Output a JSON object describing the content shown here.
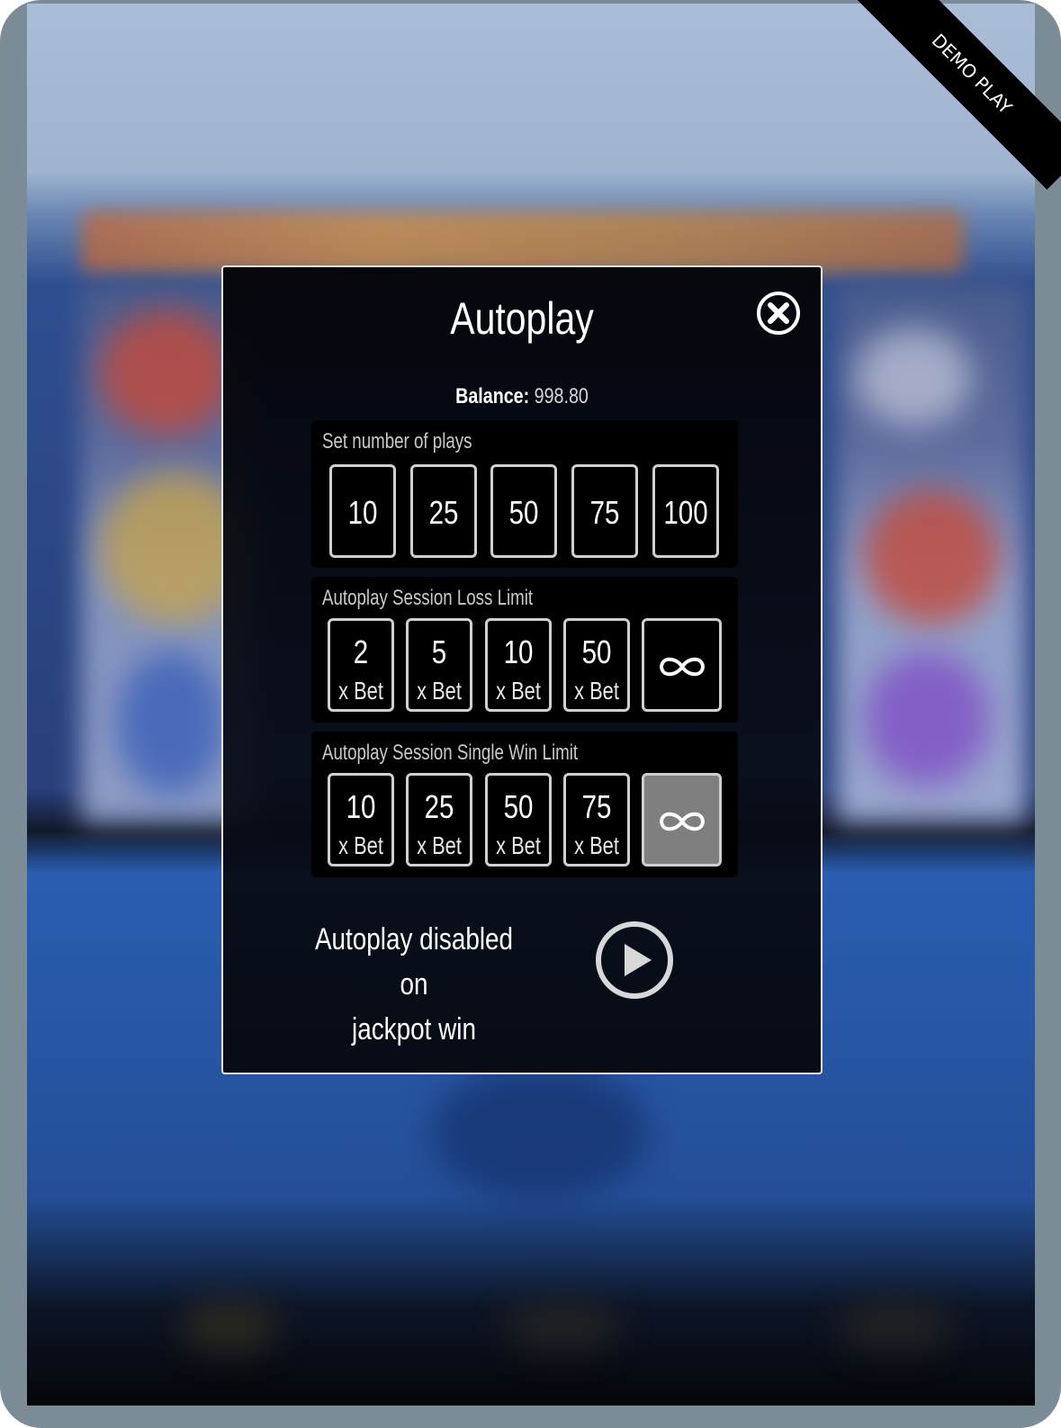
{
  "demo_ribbon": {
    "label": "DEMO PLAY"
  },
  "modal": {
    "title": "Autoplay",
    "close_icon": "close-circle-icon",
    "balance": {
      "label": "Balance:",
      "value": "998.80"
    }
  },
  "plays": {
    "label": "Set number of plays",
    "options": [
      "10",
      "25",
      "50",
      "75",
      "100"
    ]
  },
  "loss_limit": {
    "label": "Autoplay Session Loss Limit",
    "options": [
      {
        "value": "2",
        "suffix": "x Bet"
      },
      {
        "value": "5",
        "suffix": "x Bet"
      },
      {
        "value": "10",
        "suffix": "x Bet"
      },
      {
        "value": "50",
        "suffix": "x Bet"
      }
    ],
    "infinite_icon": "infinity-icon",
    "selected": "none"
  },
  "win_limit": {
    "label": "Autoplay Session Single Win Limit",
    "options": [
      {
        "value": "10",
        "suffix": "x Bet"
      },
      {
        "value": "25",
        "suffix": "x Bet"
      },
      {
        "value": "50",
        "suffix": "x Bet"
      },
      {
        "value": "75",
        "suffix": "x Bet"
      }
    ],
    "infinite_icon": "infinity-icon",
    "selected": "infinite"
  },
  "footer": {
    "line1": "Autoplay disabled on",
    "line2": "jackpot win",
    "play_icon": "play-circle-icon"
  },
  "colors": {
    "selected_option": "#7f7f7f",
    "option_border": "#cfcfcf",
    "modal_border": "#e6e6e6"
  }
}
